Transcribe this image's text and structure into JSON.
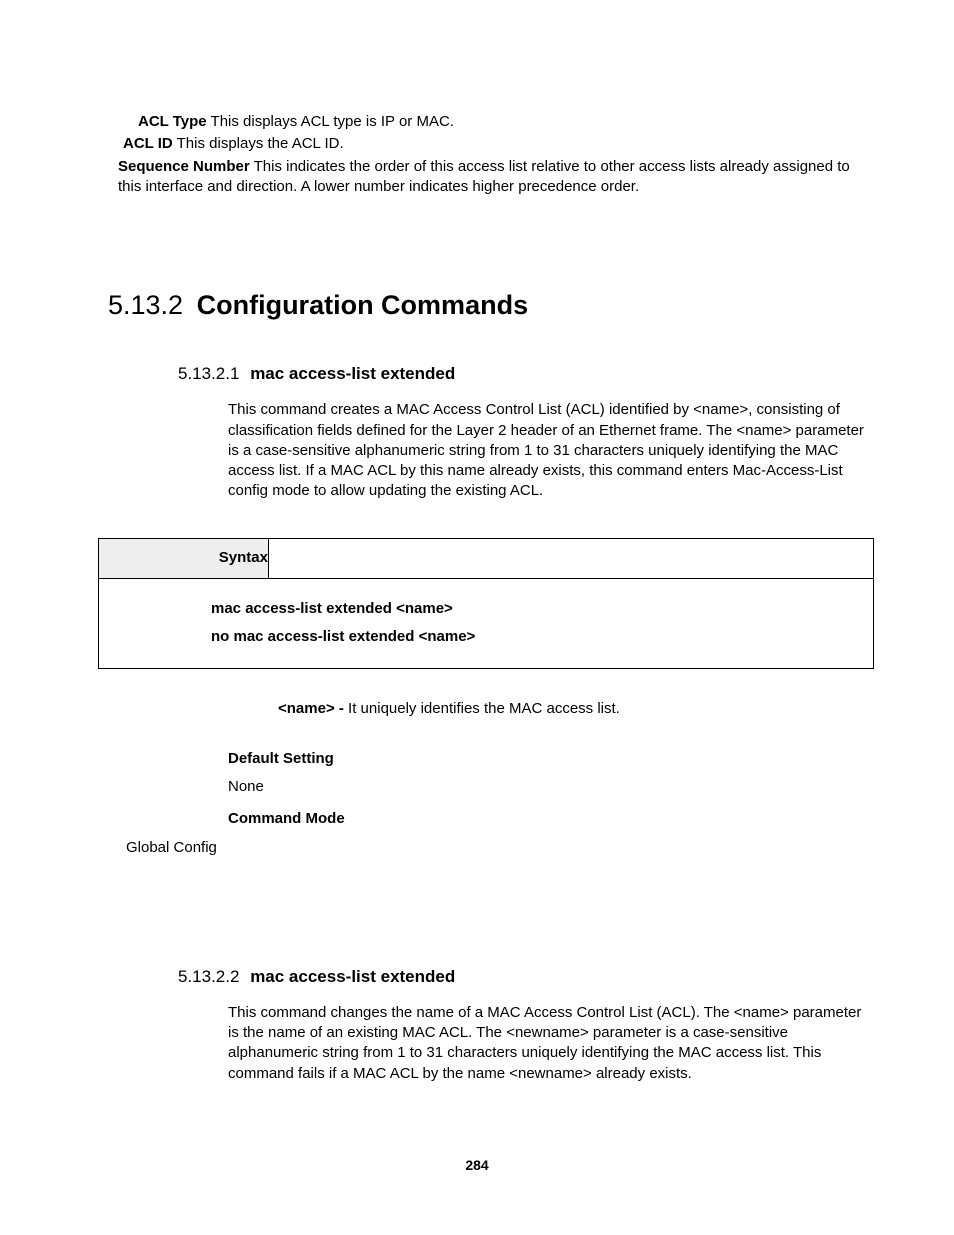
{
  "top_defs": {
    "acl_type": {
      "label": "ACL Type",
      "text": "This displays ACL type is IP or MAC."
    },
    "acl_id": {
      "label": "ACL ID",
      "text": "This displays the ACL ID."
    },
    "seq": {
      "label": "Sequence Number",
      "text": "This indicates the order of this access list relative to other access lists already assigned to this interface and direction. A lower number indicates higher precedence order."
    }
  },
  "section": {
    "num": "5.13.2",
    "title": "Configuration Commands"
  },
  "sub1": {
    "num": "5.13.2.1",
    "title": "mac access-list extended",
    "desc": "This command creates a MAC Access Control List (ACL) identified by <name>, consisting of classification fields defined for the Layer 2 header of an Ethernet frame. The <name> parameter is a case-sensitive alphanumeric string from 1 to 31 characters uniquely identifying the MAC access list. If a MAC ACL by this name already exists, this command enters Mac-Access-List config mode to allow updating the existing ACL.",
    "syntax_label": "Syntax",
    "syntax_lines": [
      "mac access-list extended <name>",
      "no mac access-list extended <name>"
    ],
    "param": {
      "name": "<name> - ",
      "text": "It uniquely identifies the MAC access list."
    },
    "default_label": "Default Setting",
    "default_value": "None",
    "mode_label": "Command Mode",
    "mode_value": "Global Config"
  },
  "sub2": {
    "num": "5.13.2.2",
    "title": "mac access-list extended",
    "desc": "This command changes the name of a MAC Access Control List (ACL). The <name> parameter is the name of an existing MAC ACL. The <newname> parameter is a case-sensitive alphanumeric string from 1 to 31 characters uniquely identifying the MAC access list. This command fails if a MAC ACL by the name <newname> already exists."
  },
  "page_number": "284"
}
